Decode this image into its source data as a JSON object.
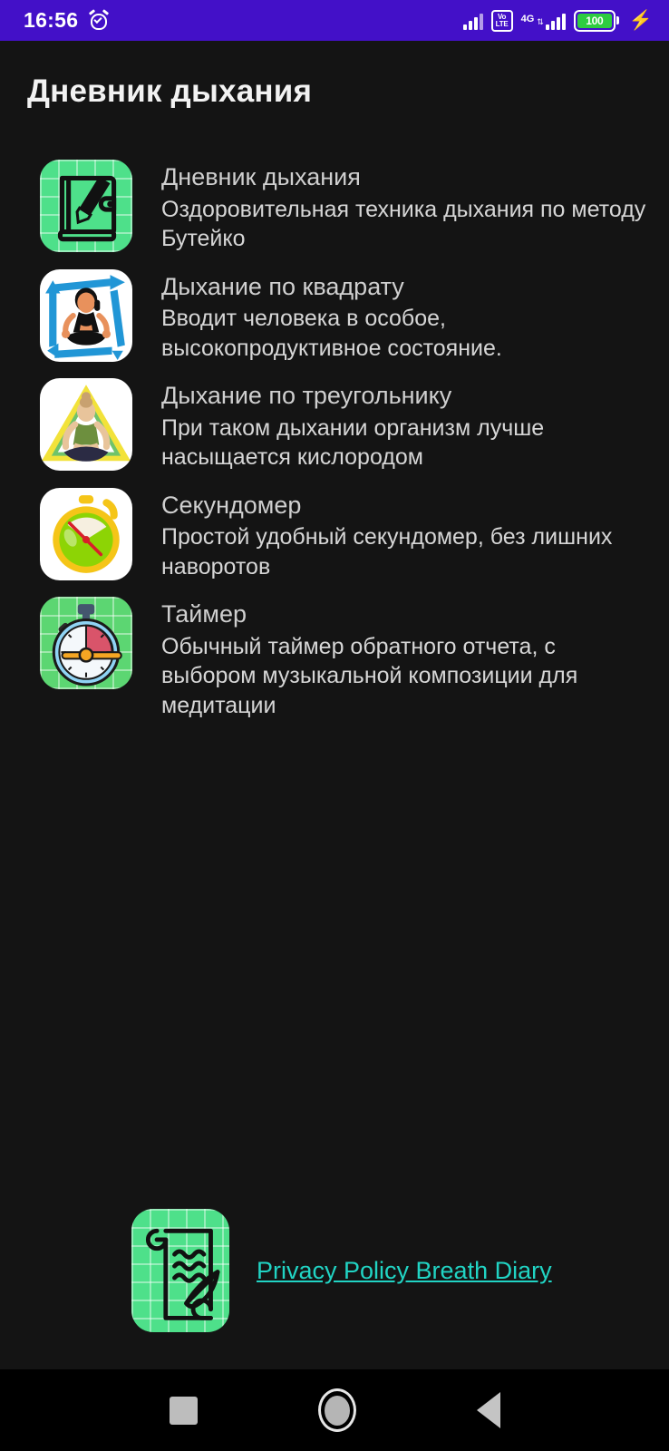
{
  "status_bar": {
    "time": "16:56",
    "alarm_icon": "alarm-clock-icon",
    "signal_icon": "signal-bars-icon",
    "volte_line1": "Vo",
    "volte_line2": "LTE",
    "network_label": "4G",
    "network_updown": "⇅",
    "battery_percent": "100",
    "charging_icon": "charging-bolt-icon",
    "background_color": "#4310C8"
  },
  "header": {
    "title": "Дневник дыхания"
  },
  "list": {
    "items": [
      {
        "icon_name": "diary-pencil-icon",
        "title": "Дневник дыхания",
        "subtitle": "Оздоровительная техника дыхания по методу Бутейко"
      },
      {
        "icon_name": "square-breathing-icon",
        "title": "Дыхание по квадрату",
        "subtitle": "Вводит человека в особое, высокопродуктивное состояние."
      },
      {
        "icon_name": "triangle-breathing-icon",
        "title": "Дыхание по треугольнику",
        "subtitle": "При таком дыхании организм лучше насыщается кислородом"
      },
      {
        "icon_name": "stopwatch-icon",
        "title": "Секундомер",
        "subtitle": "Простой удобный секундомер, без лишних наворотов"
      },
      {
        "icon_name": "timer-icon",
        "title": "Таймер",
        "subtitle": "Обычный таймер обратного отчета, с выбором музыкальной композиции для медитации"
      }
    ]
  },
  "privacy": {
    "icon_name": "scroll-quill-icon",
    "link_text": "Privacy Policy Breath Diary",
    "link_color": "#21D4C4"
  },
  "navbar": {
    "recents_label": "recents-square-icon",
    "home_label": "home-circle-icon",
    "back_label": "back-triangle-icon"
  },
  "colors": {
    "page_background": "#141414",
    "title_text": "#f2f2f2",
    "item_title": "#cfcfcf",
    "item_subtitle": "#d6d6d6",
    "accent_green": "#4ee08a"
  }
}
